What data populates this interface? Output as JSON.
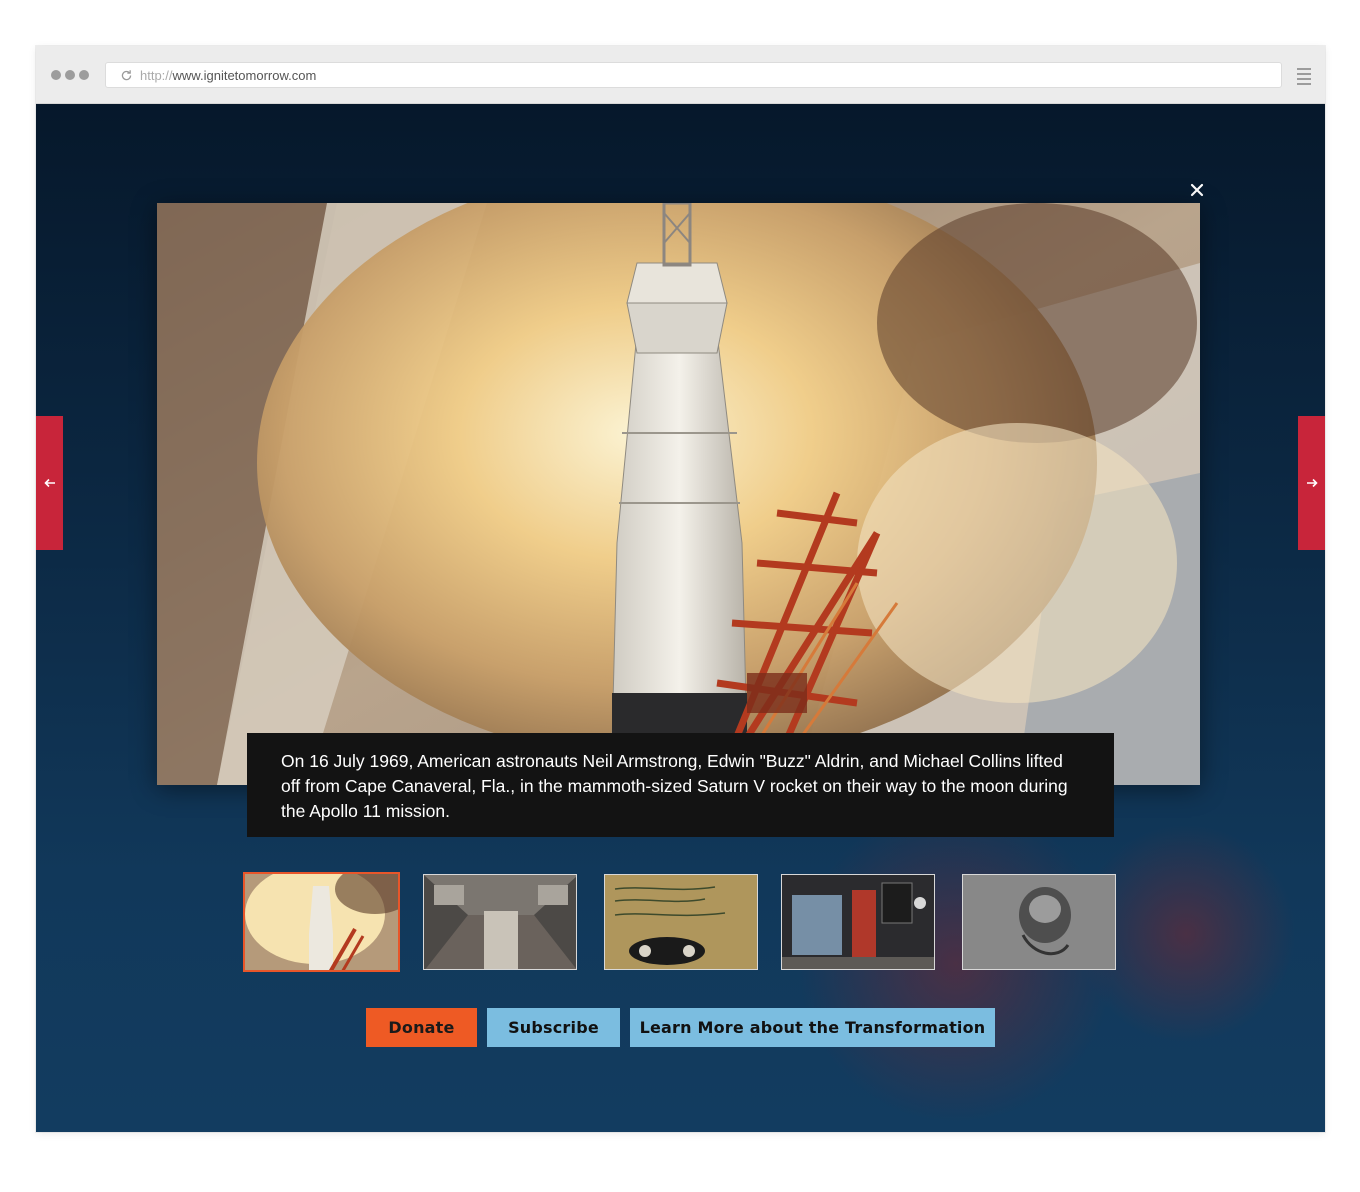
{
  "browser": {
    "url_protocol": "http://",
    "url_host": "www.ignitetomorrow.com"
  },
  "lightbox": {
    "caption": "On 16 July 1969, American astronauts Neil Armstrong, Edwin \"Buzz\" Aldrin, and Michael Collins lifted off from Cape Canaveral, Fla., in the mammoth-sized Saturn V rocket on their way to the moon during the Apollo 11 mission.",
    "thumbnails": [
      {
        "subject": "saturn-v-launch",
        "active": true
      },
      {
        "subject": "spacecraft-interior",
        "active": false
      },
      {
        "subject": "handwritten-panel",
        "active": false
      },
      {
        "subject": "museum-exhibit",
        "active": false
      },
      {
        "subject": "lunar-surface",
        "active": false
      }
    ],
    "icons": {
      "close": "close-icon",
      "prev": "arrow-left-icon",
      "next": "arrow-right-icon"
    }
  },
  "actions": {
    "donate_label": "Donate",
    "subscribe_label": "Subscribe",
    "learn_label": "Learn More about the Transformation"
  },
  "colors": {
    "accent_orange": "#ee5a24",
    "accent_blue": "#7bbde0",
    "arrow_red": "#c8253a",
    "caption_bg": "#131313"
  }
}
